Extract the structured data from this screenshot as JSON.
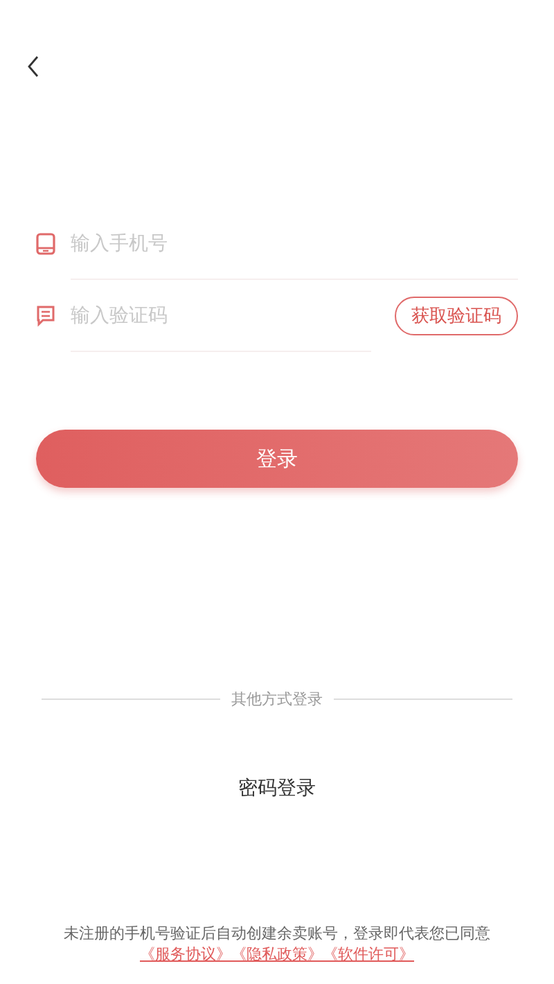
{
  "phone_field": {
    "placeholder": "输入手机号"
  },
  "code_field": {
    "placeholder": "输入验证码"
  },
  "get_code_button": "获取验证码",
  "login_button": "登录",
  "other_methods": "其他方式登录",
  "password_login": "密码登录",
  "terms": {
    "text": "未注册的手机号验证后自动创建余卖账号，登录即代表您已同意",
    "links": [
      "《服务协议》",
      "《隐私政策》",
      "《软件许可》"
    ]
  }
}
